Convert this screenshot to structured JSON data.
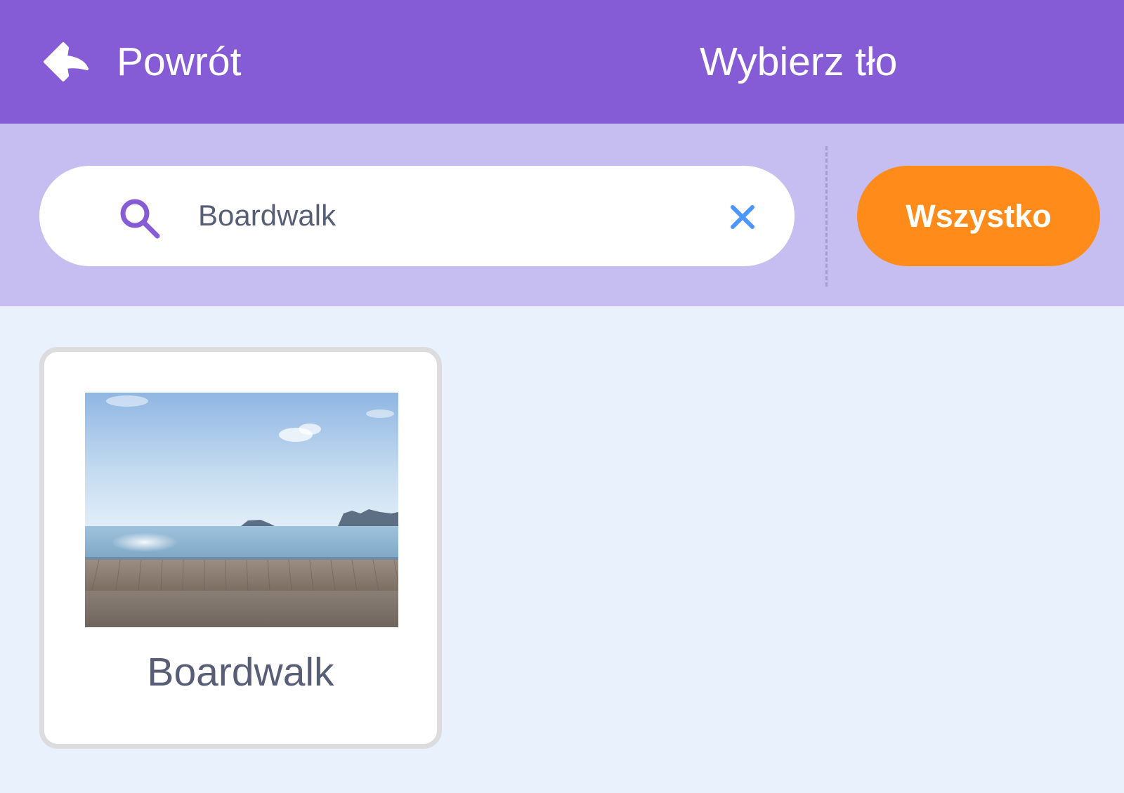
{
  "header": {
    "back_label": "Powrót",
    "title": "Wybierz tło"
  },
  "search": {
    "value": "Boardwalk",
    "placeholder": ""
  },
  "filters": {
    "all_label": "Wszystko"
  },
  "library": {
    "items": [
      {
        "name": "Boardwalk",
        "thumbnail": "boardwalk-thumbnail"
      }
    ]
  },
  "colors": {
    "header": "#855cd6",
    "filter_bar": "#c6bef0",
    "background": "#e9f1fc",
    "accent_orange": "#ff8c1a",
    "text": "#575e75",
    "clear_icon": "#4c97ff"
  }
}
